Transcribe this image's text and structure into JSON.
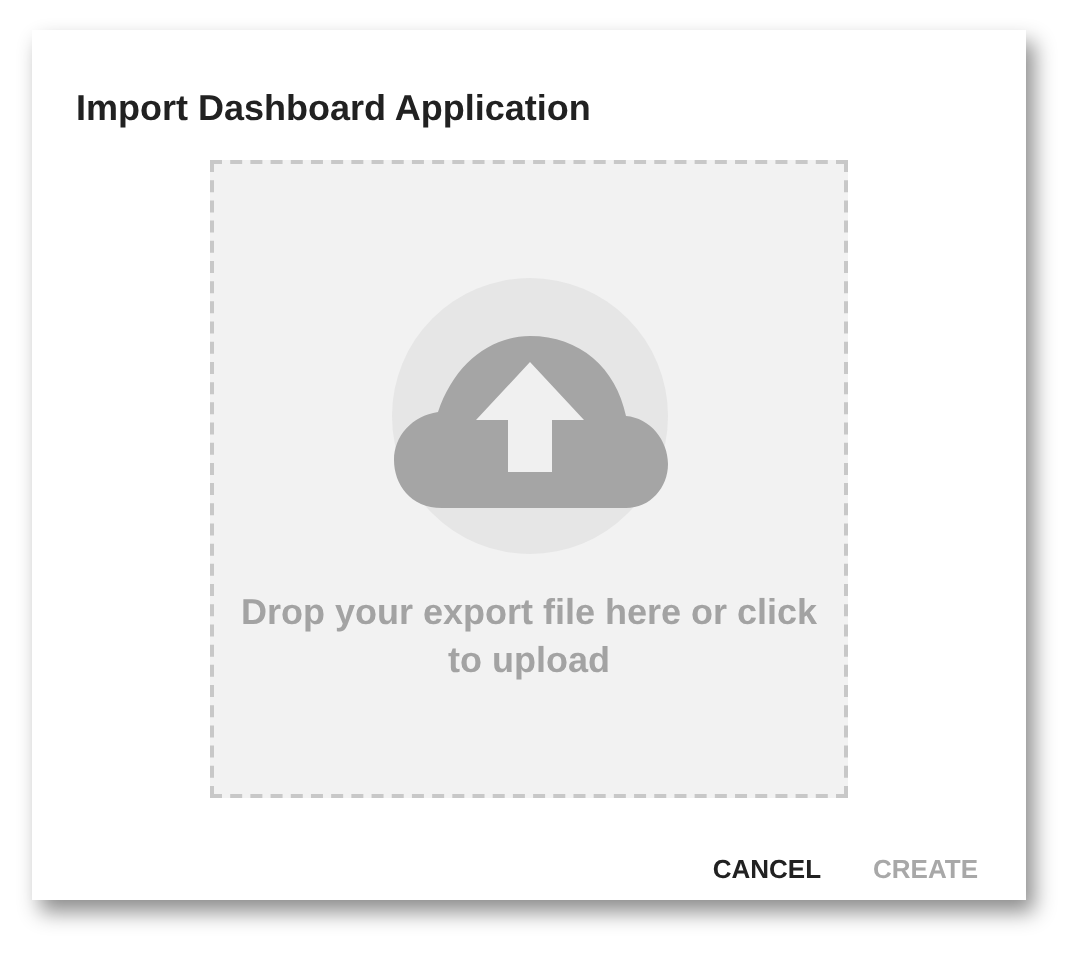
{
  "dialog": {
    "title": "Import Dashboard Application",
    "dropzone": {
      "text": "Drop your export file here or click to upload"
    },
    "buttons": [
      {
        "label": "CANCEL",
        "disabled": false
      },
      {
        "label": "CREATE",
        "disabled": true
      }
    ]
  }
}
